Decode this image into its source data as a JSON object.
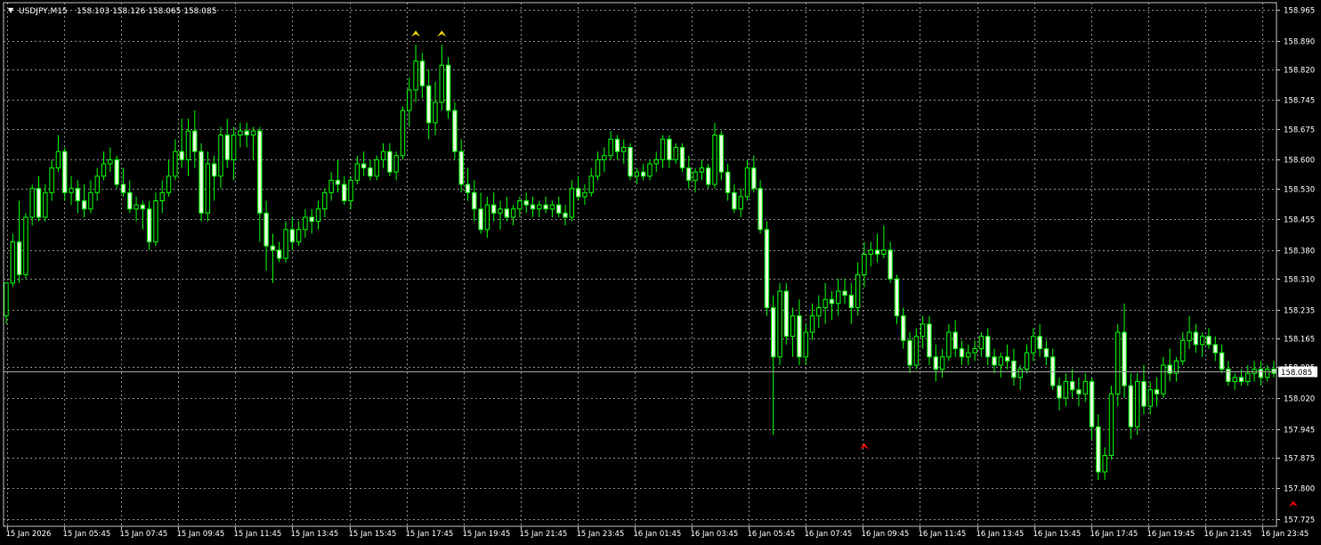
{
  "header": {
    "menu_glyph": "▼",
    "symbol_line": "USDJPY,M15",
    "ohlc_line": "158.103 158.126 158.065 158.085"
  },
  "colors": {
    "background": "#000000",
    "frame": "#c0c0c0",
    "grid": "#8a8a8a",
    "bull_body": "#000000",
    "bear_body": "#e8ffe0",
    "wick": "#00ff00",
    "bid_line": "#a0a0a0",
    "label_text": "#ffffff",
    "up_fractal": "#ffd700",
    "down_fractal": "#ff0000"
  },
  "chart_data": {
    "type": "candlestick",
    "symbol": "USDJPY",
    "timeframe": "M15",
    "ylim": [
      157.725,
      158.965
    ],
    "y_ticks": [
      "158.965",
      "158.890",
      "158.820",
      "158.745",
      "158.675",
      "158.600",
      "158.530",
      "158.455",
      "158.380",
      "158.310",
      "158.235",
      "158.165",
      "158.095",
      "158.020",
      "157.945",
      "157.875",
      "157.800",
      "157.725"
    ],
    "x_ticks": [
      "15 Jan 2026",
      "15 Jan 05:45",
      "15 Jan 07:45",
      "15 Jan 09:45",
      "15 Jan 11:45",
      "15 Jan 13:45",
      "15 Jan 15:45",
      "15 Jan 17:45",
      "15 Jan 19:45",
      "15 Jan 21:45",
      "15 Jan 23:45",
      "16 Jan 01:45",
      "16 Jan 03:45",
      "16 Jan 05:45",
      "16 Jan 07:45",
      "16 Jan 09:45",
      "16 Jan 11:45",
      "16 Jan 13:45",
      "16 Jan 15:45",
      "16 Jan 17:45",
      "16 Jan 19:45",
      "16 Jan 21:45",
      "16 Jan 23:45"
    ],
    "current_price": "158.085",
    "fractals_up": [
      {
        "index": 63,
        "price": 158.895
      },
      {
        "index": 67,
        "price": 158.895
      }
    ],
    "fractals_down": [
      {
        "index": 132,
        "price": 157.91
      },
      {
        "index": 198,
        "price": 157.77
      }
    ],
    "candles": [
      [
        158.22,
        158.3,
        158.2,
        158.3
      ],
      [
        158.3,
        158.42,
        158.29,
        158.4
      ],
      [
        158.4,
        158.5,
        158.3,
        158.32
      ],
      [
        158.32,
        158.47,
        158.31,
        158.46
      ],
      [
        158.46,
        158.54,
        158.44,
        158.53
      ],
      [
        158.53,
        158.56,
        158.45,
        158.46
      ],
      [
        158.46,
        158.54,
        158.45,
        158.52
      ],
      [
        158.52,
        158.6,
        158.5,
        158.58
      ],
      [
        158.58,
        158.66,
        158.57,
        158.62
      ],
      [
        158.62,
        158.63,
        158.5,
        158.52
      ],
      [
        158.52,
        158.56,
        158.49,
        158.53
      ],
      [
        158.53,
        158.55,
        158.47,
        158.5
      ],
      [
        158.5,
        158.54,
        158.46,
        158.48
      ],
      [
        158.48,
        158.55,
        158.47,
        158.52
      ],
      [
        158.52,
        158.58,
        158.5,
        158.56
      ],
      [
        158.56,
        158.62,
        158.55,
        158.59
      ],
      [
        158.59,
        158.63,
        158.57,
        158.6
      ],
      [
        158.6,
        158.61,
        158.53,
        158.54
      ],
      [
        158.54,
        158.58,
        158.51,
        158.52
      ],
      [
        158.52,
        158.55,
        158.47,
        158.48
      ],
      [
        158.48,
        158.51,
        158.45,
        158.49
      ],
      [
        158.49,
        158.5,
        158.43,
        158.48
      ],
      [
        158.48,
        158.5,
        158.38,
        158.4
      ],
      [
        158.4,
        158.52,
        158.39,
        158.5
      ],
      [
        158.5,
        158.55,
        158.47,
        158.52
      ],
      [
        158.52,
        158.6,
        158.51,
        158.56
      ],
      [
        158.56,
        158.65,
        158.55,
        158.62
      ],
      [
        158.62,
        158.7,
        158.58,
        158.6
      ],
      [
        158.6,
        158.7,
        158.56,
        158.67
      ],
      [
        158.67,
        158.72,
        158.58,
        158.62
      ],
      [
        158.62,
        158.64,
        158.45,
        158.47
      ],
      [
        158.47,
        158.62,
        158.45,
        158.59
      ],
      [
        158.59,
        158.61,
        158.5,
        158.56
      ],
      [
        158.56,
        158.68,
        158.53,
        158.66
      ],
      [
        158.66,
        158.7,
        158.58,
        158.6
      ],
      [
        158.6,
        158.68,
        158.55,
        158.66
      ],
      [
        158.66,
        158.69,
        158.63,
        158.67
      ],
      [
        158.67,
        158.69,
        158.63,
        158.66
      ],
      [
        158.66,
        158.68,
        158.6,
        158.67
      ],
      [
        158.67,
        158.68,
        158.4,
        158.47
      ],
      [
        158.47,
        158.5,
        158.33,
        158.39
      ],
      [
        158.39,
        158.42,
        158.3,
        158.38
      ],
      [
        158.38,
        158.4,
        158.35,
        158.36
      ],
      [
        158.36,
        158.45,
        158.35,
        158.43
      ],
      [
        158.43,
        158.46,
        158.38,
        158.4
      ],
      [
        158.4,
        158.45,
        158.39,
        158.43
      ],
      [
        158.43,
        158.48,
        158.41,
        158.46
      ],
      [
        158.46,
        158.48,
        158.42,
        158.45
      ],
      [
        158.45,
        158.5,
        158.43,
        158.48
      ],
      [
        158.48,
        158.53,
        158.46,
        158.52
      ],
      [
        158.52,
        158.57,
        158.5,
        158.55
      ],
      [
        158.55,
        158.6,
        158.52,
        158.54
      ],
      [
        158.54,
        158.56,
        158.49,
        158.5
      ],
      [
        158.5,
        158.56,
        158.48,
        158.55
      ],
      [
        158.55,
        158.61,
        158.54,
        158.59
      ],
      [
        158.59,
        158.62,
        158.56,
        158.58
      ],
      [
        158.58,
        158.6,
        158.55,
        158.56
      ],
      [
        158.56,
        158.61,
        158.55,
        158.6
      ],
      [
        158.6,
        158.64,
        158.58,
        158.62
      ],
      [
        158.62,
        158.64,
        158.56,
        158.57
      ],
      [
        158.57,
        158.62,
        158.55,
        158.61
      ],
      [
        158.61,
        158.73,
        158.6,
        158.72
      ],
      [
        158.72,
        158.8,
        158.68,
        158.77
      ],
      [
        158.77,
        158.88,
        158.74,
        158.84
      ],
      [
        158.84,
        158.86,
        158.75,
        158.78
      ],
      [
        158.78,
        158.82,
        158.65,
        158.69
      ],
      [
        158.69,
        158.79,
        158.66,
        158.74
      ],
      [
        158.74,
        158.88,
        158.72,
        158.83
      ],
      [
        158.83,
        158.85,
        158.7,
        158.72
      ],
      [
        158.72,
        158.74,
        158.6,
        158.62
      ],
      [
        158.62,
        158.65,
        158.52,
        158.54
      ],
      [
        158.54,
        158.58,
        158.5,
        158.52
      ],
      [
        158.52,
        158.55,
        158.45,
        158.48
      ],
      [
        158.48,
        158.52,
        158.42,
        158.43
      ],
      [
        158.43,
        158.51,
        158.41,
        158.49
      ],
      [
        158.49,
        158.52,
        158.45,
        158.47
      ],
      [
        158.47,
        158.5,
        158.43,
        158.48
      ],
      [
        158.48,
        158.51,
        158.45,
        158.46
      ],
      [
        158.46,
        158.49,
        158.44,
        158.48
      ],
      [
        158.48,
        158.51,
        158.46,
        158.5
      ],
      [
        158.5,
        158.52,
        158.47,
        158.49
      ],
      [
        158.49,
        158.51,
        158.46,
        158.48
      ],
      [
        158.48,
        158.5,
        158.46,
        158.49
      ],
      [
        158.49,
        158.51,
        158.47,
        158.48
      ],
      [
        158.48,
        158.5,
        158.46,
        158.49
      ],
      [
        158.49,
        158.51,
        158.46,
        158.47
      ],
      [
        158.47,
        158.49,
        158.44,
        158.46
      ],
      [
        158.46,
        158.55,
        158.45,
        158.53
      ],
      [
        158.53,
        158.56,
        158.5,
        158.51
      ],
      [
        158.51,
        158.54,
        158.49,
        158.52
      ],
      [
        158.52,
        158.58,
        158.51,
        158.56
      ],
      [
        158.56,
        158.62,
        158.55,
        158.6
      ],
      [
        158.6,
        158.63,
        158.57,
        158.61
      ],
      [
        158.61,
        158.67,
        158.6,
        158.65
      ],
      [
        158.65,
        158.66,
        158.6,
        158.62
      ],
      [
        158.62,
        158.65,
        158.59,
        158.63
      ],
      [
        158.63,
        158.64,
        158.55,
        158.56
      ],
      [
        158.56,
        158.58,
        158.54,
        158.57
      ],
      [
        158.57,
        158.59,
        158.55,
        158.56
      ],
      [
        158.56,
        158.6,
        158.55,
        158.59
      ],
      [
        158.59,
        158.62,
        158.57,
        158.6
      ],
      [
        158.6,
        158.66,
        158.58,
        158.65
      ],
      [
        158.65,
        158.66,
        158.58,
        158.6
      ],
      [
        158.6,
        158.64,
        158.59,
        158.63
      ],
      [
        158.63,
        158.64,
        158.57,
        158.58
      ],
      [
        158.58,
        158.61,
        158.53,
        158.55
      ],
      [
        158.55,
        158.58,
        158.52,
        158.57
      ],
      [
        158.57,
        158.6,
        158.55,
        158.58
      ],
      [
        158.58,
        158.59,
        158.53,
        158.54
      ],
      [
        158.54,
        158.69,
        158.53,
        158.66
      ],
      [
        158.66,
        158.67,
        158.55,
        158.57
      ],
      [
        158.57,
        158.59,
        158.5,
        158.52
      ],
      [
        158.52,
        158.54,
        158.47,
        158.48
      ],
      [
        158.48,
        158.53,
        158.46,
        158.51
      ],
      [
        158.51,
        158.6,
        158.5,
        158.58
      ],
      [
        158.58,
        158.61,
        158.52,
        158.53
      ],
      [
        158.53,
        158.55,
        158.42,
        158.43
      ],
      [
        158.43,
        158.45,
        158.22,
        158.24
      ],
      [
        158.24,
        158.27,
        157.93,
        158.12
      ],
      [
        158.12,
        158.3,
        158.1,
        158.28
      ],
      [
        158.28,
        158.3,
        158.15,
        158.17
      ],
      [
        158.17,
        158.24,
        158.12,
        158.22
      ],
      [
        158.22,
        158.26,
        158.1,
        158.12
      ],
      [
        158.12,
        158.2,
        158.1,
        158.18
      ],
      [
        158.18,
        158.25,
        158.16,
        158.22
      ],
      [
        158.22,
        158.27,
        158.19,
        158.24
      ],
      [
        158.24,
        158.3,
        158.2,
        158.26
      ],
      [
        158.26,
        158.28,
        158.21,
        158.25
      ],
      [
        158.25,
        158.31,
        158.22,
        158.28
      ],
      [
        158.28,
        158.31,
        158.25,
        158.27
      ],
      [
        158.27,
        158.3,
        158.2,
        158.24
      ],
      [
        158.24,
        158.35,
        158.22,
        158.32
      ],
      [
        158.32,
        158.4,
        158.29,
        158.37
      ],
      [
        158.37,
        158.4,
        158.34,
        158.38
      ],
      [
        158.38,
        158.42,
        158.35,
        158.37
      ],
      [
        158.37,
        158.44,
        158.36,
        158.38
      ],
      [
        158.38,
        158.4,
        158.3,
        158.31
      ],
      [
        158.31,
        158.32,
        158.2,
        158.22
      ],
      [
        158.22,
        158.24,
        158.14,
        158.16
      ],
      [
        158.16,
        158.18,
        158.08,
        158.1
      ],
      [
        158.1,
        158.19,
        158.09,
        158.17
      ],
      [
        158.17,
        158.22,
        158.14,
        158.2
      ],
      [
        158.2,
        158.22,
        158.1,
        158.12
      ],
      [
        158.12,
        158.15,
        158.06,
        158.09
      ],
      [
        158.09,
        158.14,
        158.07,
        158.12
      ],
      [
        158.12,
        158.2,
        158.11,
        158.18
      ],
      [
        158.18,
        158.21,
        158.12,
        158.14
      ],
      [
        158.14,
        158.16,
        158.1,
        158.12
      ],
      [
        158.12,
        158.15,
        158.1,
        158.13
      ],
      [
        158.13,
        158.16,
        158.11,
        158.14
      ],
      [
        158.14,
        158.18,
        158.12,
        158.17
      ],
      [
        158.17,
        158.19,
        158.1,
        158.12
      ],
      [
        158.12,
        158.14,
        158.08,
        158.1
      ],
      [
        158.1,
        158.13,
        158.07,
        158.12
      ],
      [
        158.12,
        158.15,
        158.09,
        158.11
      ],
      [
        158.11,
        158.14,
        158.05,
        158.07
      ],
      [
        158.07,
        158.1,
        158.04,
        158.09
      ],
      [
        158.09,
        158.15,
        158.08,
        158.13
      ],
      [
        158.13,
        158.19,
        158.11,
        158.17
      ],
      [
        158.17,
        158.2,
        158.12,
        158.14
      ],
      [
        158.14,
        158.16,
        158.1,
        158.12
      ],
      [
        158.12,
        158.14,
        158.04,
        158.05
      ],
      [
        158.05,
        158.07,
        157.99,
        158.02
      ],
      [
        158.02,
        158.08,
        158.0,
        158.06
      ],
      [
        158.06,
        158.09,
        158.02,
        158.04
      ],
      [
        158.04,
        158.07,
        158.0,
        158.03
      ],
      [
        158.03,
        158.08,
        158.01,
        158.06
      ],
      [
        158.06,
        158.07,
        157.92,
        157.95
      ],
      [
        157.95,
        157.98,
        157.82,
        157.84
      ],
      [
        157.84,
        157.9,
        157.82,
        157.88
      ],
      [
        157.88,
        158.05,
        157.87,
        158.03
      ],
      [
        158.03,
        158.2,
        158.0,
        158.18
      ],
      [
        158.18,
        158.25,
        158.02,
        158.05
      ],
      [
        158.05,
        158.08,
        157.92,
        157.95
      ],
      [
        157.95,
        158.08,
        157.93,
        158.06
      ],
      [
        158.06,
        158.1,
        157.98,
        158.0
      ],
      [
        158.0,
        158.06,
        157.98,
        158.04
      ],
      [
        158.04,
        158.07,
        158.0,
        158.03
      ],
      [
        158.03,
        158.12,
        158.02,
        158.1
      ],
      [
        158.1,
        158.14,
        158.06,
        158.08
      ],
      [
        158.08,
        158.12,
        158.06,
        158.11
      ],
      [
        158.11,
        158.18,
        158.1,
        158.16
      ],
      [
        158.16,
        158.22,
        158.14,
        158.18
      ],
      [
        158.18,
        158.2,
        158.13,
        158.15
      ],
      [
        158.15,
        158.18,
        158.12,
        158.17
      ],
      [
        158.17,
        158.19,
        158.14,
        158.15
      ],
      [
        158.15,
        158.17,
        158.11,
        158.13
      ],
      [
        158.13,
        158.15,
        158.08,
        158.09
      ],
      [
        158.09,
        158.11,
        158.05,
        158.06
      ],
      [
        158.06,
        158.08,
        158.04,
        158.07
      ],
      [
        158.07,
        158.09,
        158.05,
        158.06
      ],
      [
        158.06,
        158.1,
        158.05,
        158.08
      ],
      [
        158.08,
        158.11,
        158.06,
        158.09
      ],
      [
        158.09,
        158.11,
        158.05,
        158.07
      ],
      [
        158.07,
        158.1,
        158.06,
        158.09
      ],
      [
        158.09,
        158.11,
        158.07,
        158.08
      ]
    ]
  }
}
